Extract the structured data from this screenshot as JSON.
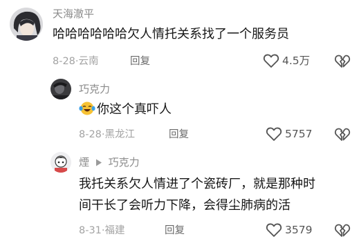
{
  "colors": {
    "username": "#8a8a8a",
    "text": "#161616",
    "meta": "#a3a3a3",
    "reply": "#6a6a6a"
  },
  "comments": [
    {
      "username": "天海澈平",
      "text": "哈哈哈哈哈哈欠人情托关系找了一个服务员",
      "date": "8-28",
      "location": "云南",
      "reply_label": "回复",
      "likes": "4.5万",
      "avatar_icon": "anime-avatar",
      "like_icon": "heart-outline-icon",
      "dislike_icon": "broken-heart-icon"
    },
    {
      "username": "巧克力",
      "emoji_icon": "laughing-crying-emoji-icon",
      "text": "你这个真吓人",
      "date": "8-28",
      "location": "黑龙江",
      "reply_label": "回复",
      "likes": "5757",
      "avatar_icon": "dark-photo-avatar",
      "like_icon": "heart-outline-icon",
      "dislike_icon": "broken-heart-icon"
    },
    {
      "username": "煙",
      "reply_to": "巧克力",
      "reply_arrow_icon": "triangle-right-icon",
      "text_line1": "我托关系欠人情进了个瓷砖厂，就是那种时",
      "text_line2": "间干长了会听力下降，会得尘肺病的活",
      "date": "8-31",
      "location": "福建",
      "reply_label": "回复",
      "likes": "3579",
      "avatar_icon": "cartoon-avatar",
      "like_icon": "heart-outline-icon",
      "dislike_icon": "broken-heart-icon"
    }
  ]
}
